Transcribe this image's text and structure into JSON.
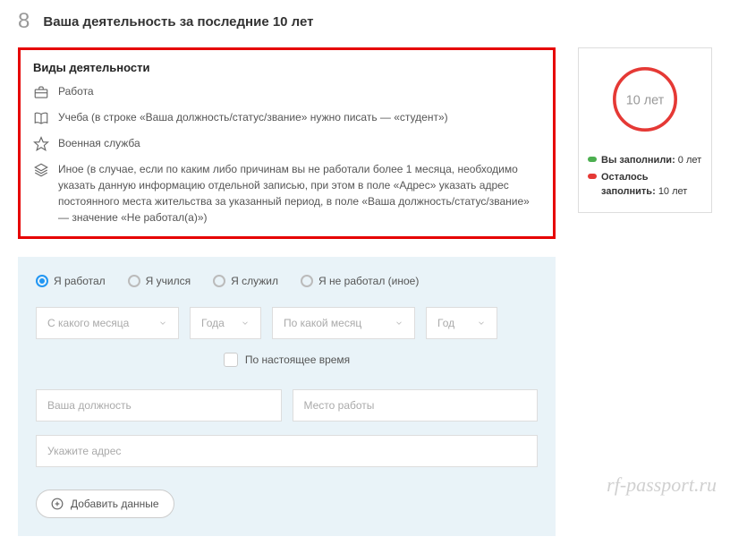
{
  "section": {
    "number": "8",
    "title": "Ваша деятельность за последние 10 лет"
  },
  "info": {
    "title": "Виды деятельности",
    "items": [
      {
        "text": "Работа"
      },
      {
        "text": "Учеба (в строке «Ваша должность/статус/звание» нужно писать — «студент»)"
      },
      {
        "text": "Военная служба"
      },
      {
        "text": "Иное (в случае, если по каким либо причинам вы не работали более 1 месяца, необходимо указать данную информацию отдельной записью, при этом в поле «Адрес» указать адрес постоянного места жительства за указанный период, в поле «Ваша должность/статус/звание» — значение «Не работал(а)»)"
      }
    ]
  },
  "status": {
    "circle_label": "10 лет",
    "filled_label": "Вы заполнили:",
    "filled_value": "0 лет",
    "remaining_label": "Осталось заполнить:",
    "remaining_value": "10 лет"
  },
  "form": {
    "radios": {
      "work": "Я работал",
      "study": "Я учился",
      "military": "Я служил",
      "none": "Я не работал (иное)"
    },
    "from_month": "С какого месяца",
    "from_year": "Года",
    "to_month": "По какой месяц",
    "to_year": "Год",
    "present": "По настоящее время",
    "position": "Ваша должность",
    "workplace": "Место работы",
    "address": "Укажите адрес",
    "add": "Добавить данные"
  },
  "watermark": "rf-passport.ru"
}
